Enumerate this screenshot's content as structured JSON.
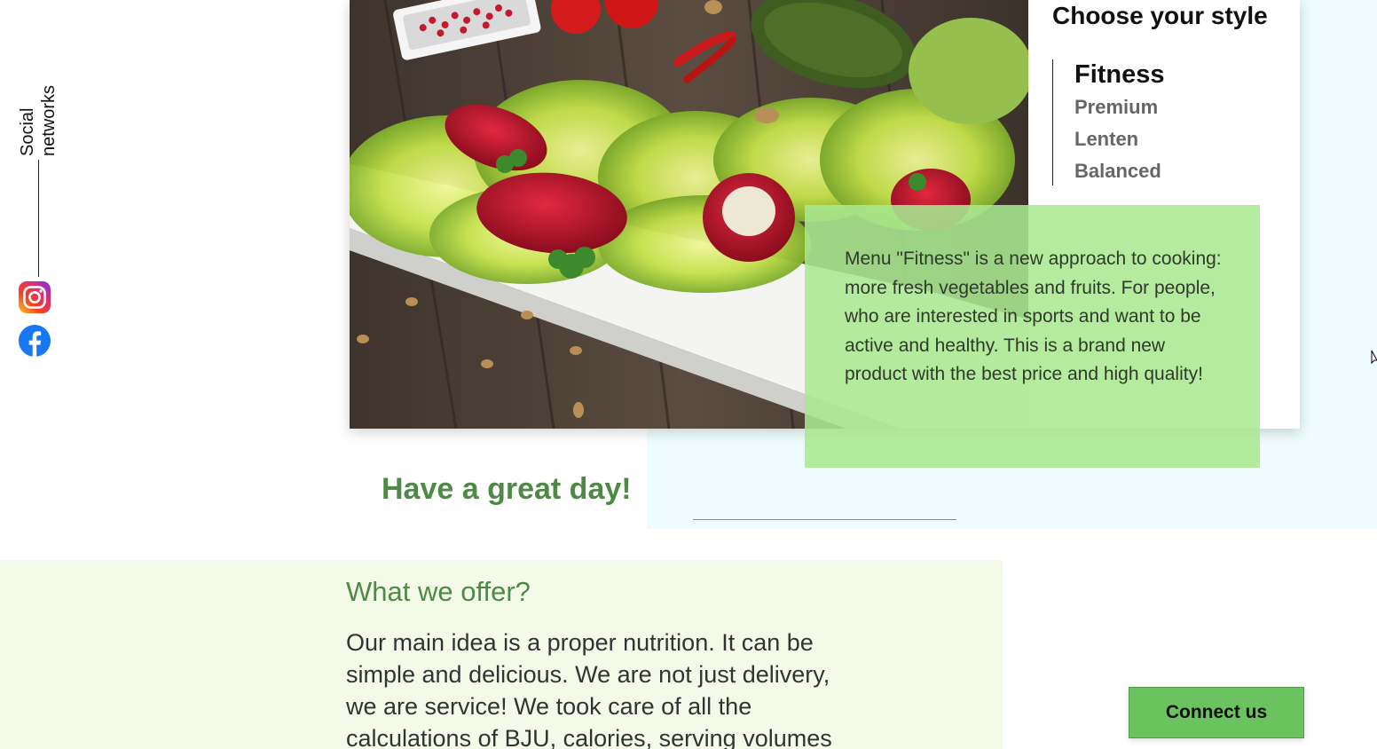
{
  "social": {
    "label_line1": "Social",
    "label_line2": "networks",
    "icons": [
      "instagram-icon",
      "facebook-icon"
    ]
  },
  "styles": {
    "title": "Choose your style",
    "items": [
      {
        "label": "Fitness",
        "active": true
      },
      {
        "label": "Premium",
        "active": false
      },
      {
        "label": "Lenten",
        "active": false
      },
      {
        "label": "Balanced",
        "active": false
      }
    ],
    "description": "Menu \"Fitness\" is a new approach to cooking: more fresh vegetables and fruits. For people, who are interested in sports and want to be active and healthy. This is a brand new product with the best price and high quality!"
  },
  "greeting": "Have a great day!",
  "offer": {
    "title": "What we offer?",
    "text": "Our main idea is a proper nutrition. It can be simple and delicious. We are not just delivery, we are service! We took care of all the calculations of BJU, calories, serving volumes"
  },
  "connect_button": "Connect us",
  "colors": {
    "accent_green": "#4e8a45",
    "button_green": "#6ac35f",
    "desc_box_green": "#aae891",
    "offer_bg": "#f3fbe8",
    "hero_tint": "#eefcfd"
  }
}
